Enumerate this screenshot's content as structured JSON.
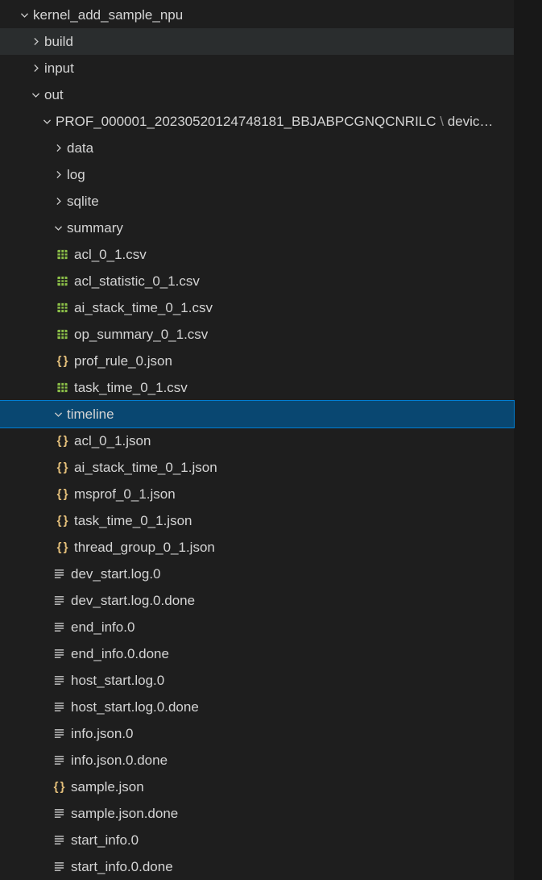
{
  "tree": [
    {
      "indent": 22,
      "kind": "folder",
      "state": "open",
      "label": "kernel_add_sample_npu",
      "bold": true
    },
    {
      "indent": 36,
      "kind": "folder",
      "state": "closed",
      "label": "build",
      "hover": true
    },
    {
      "indent": 36,
      "kind": "folder",
      "state": "closed",
      "label": "input"
    },
    {
      "indent": 36,
      "kind": "folder",
      "state": "open",
      "label": "out"
    },
    {
      "indent": 50,
      "kind": "folder",
      "state": "open",
      "label": "PROF_000001_20230520124748181_BBJABPCGNQCNRILC",
      "pathtail": "devic…"
    },
    {
      "indent": 64,
      "kind": "folder",
      "state": "closed",
      "label": "data"
    },
    {
      "indent": 64,
      "kind": "folder",
      "state": "closed",
      "label": "log"
    },
    {
      "indent": 64,
      "kind": "folder",
      "state": "closed",
      "label": "sqlite"
    },
    {
      "indent": 64,
      "kind": "folder",
      "state": "open",
      "label": "summary"
    },
    {
      "indent": 68,
      "kind": "file",
      "icon": "csv",
      "label": "acl_0_1.csv"
    },
    {
      "indent": 68,
      "kind": "file",
      "icon": "csv",
      "label": "acl_statistic_0_1.csv"
    },
    {
      "indent": 68,
      "kind": "file",
      "icon": "csv",
      "label": "ai_stack_time_0_1.csv"
    },
    {
      "indent": 68,
      "kind": "file",
      "icon": "csv",
      "label": "op_summary_0_1.csv"
    },
    {
      "indent": 68,
      "kind": "file",
      "icon": "json",
      "label": "prof_rule_0.json"
    },
    {
      "indent": 68,
      "kind": "file",
      "icon": "csv",
      "label": "task_time_0_1.csv"
    },
    {
      "indent": 64,
      "kind": "folder",
      "state": "open",
      "label": "timeline",
      "selected": true
    },
    {
      "indent": 68,
      "kind": "file",
      "icon": "json",
      "label": "acl_0_1.json"
    },
    {
      "indent": 68,
      "kind": "file",
      "icon": "json",
      "label": "ai_stack_time_0_1.json"
    },
    {
      "indent": 68,
      "kind": "file",
      "icon": "json",
      "label": "msprof_0_1.json"
    },
    {
      "indent": 68,
      "kind": "file",
      "icon": "json",
      "label": "task_time_0_1.json"
    },
    {
      "indent": 68,
      "kind": "file",
      "icon": "json",
      "label": "thread_group_0_1.json"
    },
    {
      "indent": 64,
      "kind": "file",
      "icon": "text",
      "label": "dev_start.log.0"
    },
    {
      "indent": 64,
      "kind": "file",
      "icon": "text",
      "label": "dev_start.log.0.done"
    },
    {
      "indent": 64,
      "kind": "file",
      "icon": "text",
      "label": "end_info.0"
    },
    {
      "indent": 64,
      "kind": "file",
      "icon": "text",
      "label": "end_info.0.done"
    },
    {
      "indent": 64,
      "kind": "file",
      "icon": "text",
      "label": "host_start.log.0"
    },
    {
      "indent": 64,
      "kind": "file",
      "icon": "text",
      "label": "host_start.log.0.done"
    },
    {
      "indent": 64,
      "kind": "file",
      "icon": "text",
      "label": "info.json.0"
    },
    {
      "indent": 64,
      "kind": "file",
      "icon": "text",
      "label": "info.json.0.done"
    },
    {
      "indent": 64,
      "kind": "file",
      "icon": "json",
      "label": "sample.json"
    },
    {
      "indent": 64,
      "kind": "file",
      "icon": "text",
      "label": "sample.json.done"
    },
    {
      "indent": 64,
      "kind": "file",
      "icon": "text",
      "label": "start_info.0"
    },
    {
      "indent": 64,
      "kind": "file",
      "icon": "text",
      "label": "start_info.0.done"
    }
  ]
}
